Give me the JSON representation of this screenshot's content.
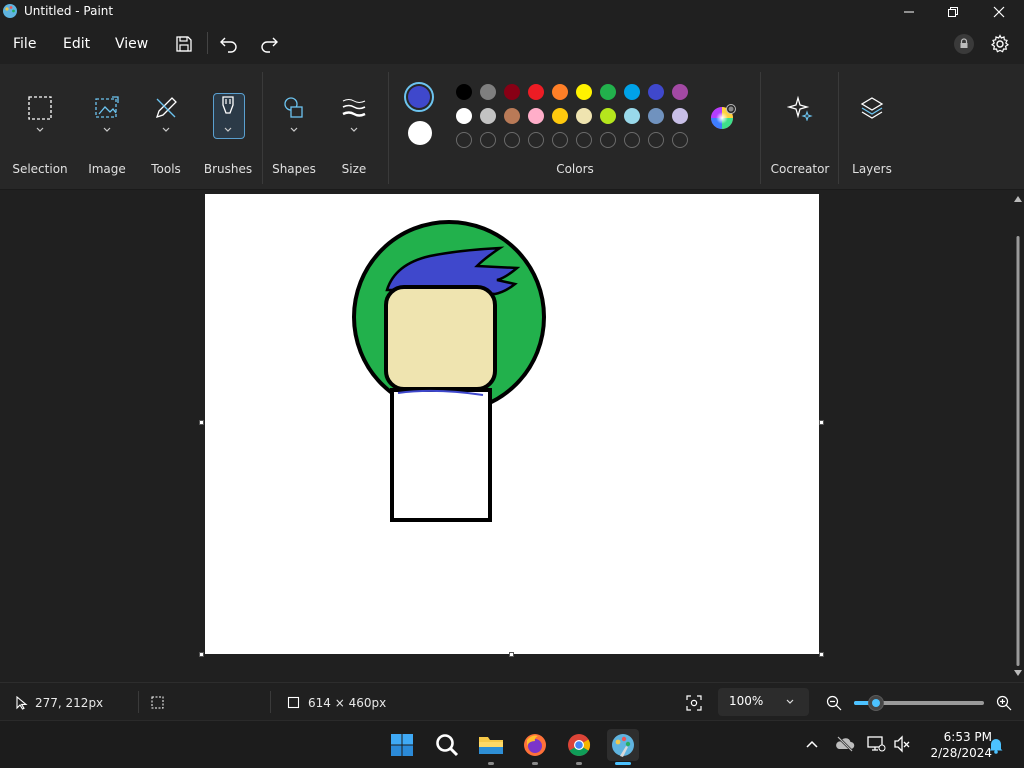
{
  "window": {
    "title": "Untitled - Paint"
  },
  "menu": {
    "file": "File",
    "edit": "Edit",
    "view": "View"
  },
  "ribbon": {
    "selection": "Selection",
    "image": "Image",
    "tools": "Tools",
    "brushes": "Brushes",
    "shapes": "Shapes",
    "size": "Size",
    "colors": "Colors",
    "cocreator": "Cocreator",
    "layers": "Layers"
  },
  "colors": {
    "primary": "#3f48cc",
    "secondary": "#ffffff",
    "row1": [
      "#000000",
      "#7f7f7f",
      "#880015",
      "#ed1c24",
      "#ff7f27",
      "#fff200",
      "#22b14c",
      "#00a2e8",
      "#3f48cc",
      "#a349a4"
    ],
    "row2": [
      "#ffffff",
      "#c3c3c3",
      "#b97a57",
      "#ffaec9",
      "#ffc90e",
      "#efe4b0",
      "#b5e61d",
      "#99d9ea",
      "#7092be",
      "#c8bfe7"
    ]
  },
  "drawing": {
    "green": "#22b14c",
    "skin": "#efe4b0",
    "blue": "#3f48cc"
  },
  "status": {
    "cursor_position": "277, 212px",
    "canvas_size": "614 × 460px",
    "zoom": "100%",
    "zoom_fraction": 0.17
  },
  "clock": {
    "time": "6:53 PM",
    "date": "2/28/2024"
  }
}
